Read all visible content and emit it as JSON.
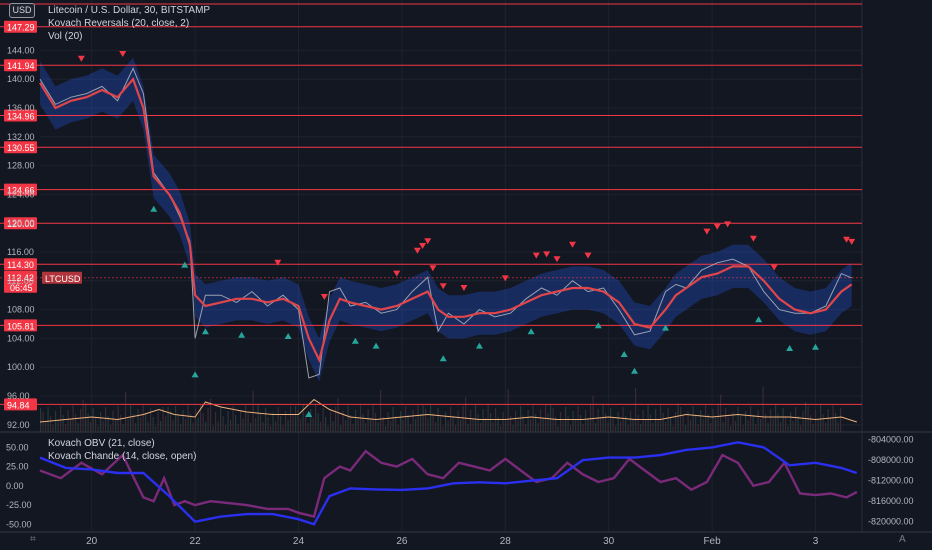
{
  "window": {
    "currency_badge": "USD",
    "auto_scale_label": "A"
  },
  "legend_top": [
    "Litecoin / U.S. Dollar, 30, BITSTAMP",
    "Kovach Reversals (20, close, 2)",
    "Vol (20)"
  ],
  "legend_bottom": [
    "Kovach OBV (21, close)",
    "Kovach Chande (14, close, open)"
  ],
  "colors": {
    "background": "#131722",
    "price": "#b2b5be",
    "ma": "#e0454a",
    "band": "#2962ff",
    "level": "#f23645",
    "volume_ma": "#f0b27a",
    "obv": "#2a2ff0",
    "chande": "#7b2a7a",
    "up_marker": "#26a69a",
    "down_marker": "#f23645",
    "axis_text": "#b2b5be",
    "grid": "#1e222d"
  },
  "chart_data": [
    {
      "type": "line",
      "title": "Litecoin / U.S. Dollar, 30, BITSTAMP",
      "ylim": [
        91,
        151
      ],
      "xlim": [
        19.0,
        34.9
      ],
      "x_tick_labels": [
        {
          "x": 20,
          "label": "20"
        },
        {
          "x": 22,
          "label": "22"
        },
        {
          "x": 24,
          "label": "24"
        },
        {
          "x": 26,
          "label": "26"
        },
        {
          "x": 28,
          "label": "28"
        },
        {
          "x": 30,
          "label": "30"
        },
        {
          "x": 32,
          "label": "Feb"
        },
        {
          "x": 34,
          "label": "3"
        }
      ],
      "y_ticks": [
        92,
        96,
        100,
        104,
        108,
        112,
        116,
        120,
        124,
        128,
        132,
        136,
        140,
        144
      ],
      "y_tick_labels": [
        "92.00",
        "96.00",
        "100.00",
        "104.00",
        "108.00",
        "112.00",
        "116.00",
        "120.00",
        "124.00",
        "128.00",
        "132.00",
        "136.00",
        "140.00",
        "144.00"
      ],
      "levels": [
        {
          "value": 147.29,
          "label": "147.29"
        },
        {
          "value": 141.94,
          "label": "141.94"
        },
        {
          "value": 134.96,
          "label": "134.96"
        },
        {
          "value": 130.55,
          "label": "130.55"
        },
        {
          "value": 124.66,
          "label": "124.66"
        },
        {
          "value": 120.0,
          "label": "120.00"
        },
        {
          "value": 114.3,
          "label": "114.30"
        },
        {
          "value": 105.81,
          "label": "105.81"
        },
        {
          "value": 94.84,
          "label": "94.84"
        }
      ],
      "current": {
        "label": "112.42",
        "symbol": "LTCUSD",
        "countdown": "06:45",
        "value": 112.42
      },
      "series": [
        {
          "name": "LTCUSD",
          "x": [
            19.0,
            19.3,
            19.6,
            19.9,
            20.2,
            20.5,
            20.8,
            21.0,
            21.2,
            21.5,
            21.7,
            21.9,
            22.0,
            22.2,
            22.5,
            22.8,
            23.1,
            23.4,
            23.7,
            24.0,
            24.2,
            24.4,
            24.6,
            24.8,
            25.0,
            25.3,
            25.6,
            25.9,
            26.2,
            26.5,
            26.7,
            26.9,
            27.2,
            27.5,
            27.8,
            28.1,
            28.4,
            28.7,
            29.0,
            29.3,
            29.6,
            29.9,
            30.2,
            30.5,
            30.8,
            31.1,
            31.3,
            31.5,
            31.8,
            32.1,
            32.4,
            32.7,
            33.0,
            33.3,
            33.6,
            33.9,
            34.2,
            34.5,
            34.7
          ],
          "values": [
            140.0,
            136.5,
            137.5,
            138.0,
            139.0,
            137.0,
            141.5,
            138.0,
            127.0,
            124.0,
            121.0,
            117.5,
            104.0,
            110.0,
            110.0,
            109.0,
            110.5,
            108.5,
            110.0,
            108.0,
            98.5,
            99.0,
            110.5,
            111.0,
            108.5,
            109.0,
            107.5,
            108.0,
            110.5,
            112.5,
            105.0,
            107.5,
            106.0,
            108.0,
            107.0,
            107.5,
            109.5,
            111.0,
            110.0,
            112.0,
            110.5,
            111.0,
            108.0,
            104.5,
            105.0,
            110.5,
            111.5,
            111.0,
            113.5,
            114.5,
            115.0,
            114.0,
            110.5,
            108.0,
            107.5,
            107.5,
            108.5,
            113.0,
            112.4
          ]
        },
        {
          "name": "MA",
          "x": [
            19.0,
            19.3,
            19.6,
            19.9,
            20.2,
            20.5,
            20.8,
            21.0,
            21.2,
            21.5,
            21.7,
            21.9,
            22.0,
            22.2,
            22.5,
            22.8,
            23.1,
            23.4,
            23.7,
            24.0,
            24.2,
            24.4,
            24.6,
            24.8,
            25.0,
            25.3,
            25.6,
            25.9,
            26.2,
            26.5,
            26.7,
            26.9,
            27.2,
            27.5,
            27.8,
            28.1,
            28.4,
            28.7,
            29.0,
            29.3,
            29.6,
            29.9,
            30.2,
            30.5,
            30.8,
            31.1,
            31.3,
            31.5,
            31.8,
            32.1,
            32.4,
            32.7,
            33.0,
            33.3,
            33.6,
            33.9,
            34.2,
            34.5,
            34.7
          ],
          "values": [
            139.5,
            136.0,
            137.0,
            137.5,
            138.5,
            137.5,
            140.0,
            136.0,
            126.5,
            124.0,
            121.5,
            117.0,
            110.0,
            108.5,
            109.0,
            109.5,
            109.5,
            109.0,
            109.5,
            108.5,
            104.0,
            101.0,
            106.5,
            109.5,
            109.0,
            108.5,
            108.0,
            108.5,
            109.5,
            110.5,
            108.0,
            107.0,
            107.0,
            107.5,
            107.5,
            108.0,
            109.0,
            110.0,
            110.5,
            111.0,
            111.0,
            110.5,
            109.0,
            106.0,
            105.5,
            108.0,
            110.0,
            111.0,
            112.5,
            113.0,
            114.0,
            114.0,
            112.0,
            109.5,
            108.0,
            107.5,
            108.0,
            110.5,
            111.5
          ]
        }
      ],
      "down_markers": [
        19.8,
        20.6,
        23.6,
        24.5,
        25.9,
        26.3,
        26.4,
        26.5,
        26.6,
        26.8,
        27.2,
        28.0,
        28.6,
        28.8,
        29.0,
        29.3,
        29.6,
        31.9,
        32.1,
        32.3,
        32.8,
        33.2,
        34.6,
        34.7
      ],
      "up_markers": [
        21.2,
        21.8,
        22.0,
        22.2,
        22.9,
        23.8,
        24.2,
        25.1,
        25.5,
        26.8,
        27.5,
        28.5,
        29.8,
        30.3,
        30.5,
        31.1,
        32.9,
        33.5,
        34.0
      ]
    },
    {
      "type": "line",
      "title": "Kovach OBV / Kovach Chande",
      "ylim": [
        -60,
        70
      ],
      "right_ylim": [
        -822000,
        -802500
      ],
      "y_ticks": [
        50,
        25,
        0,
        -25,
        -50
      ],
      "y_tick_labels": [
        "50.00",
        "25.00",
        "0.00",
        "-25.00",
        "-50.00"
      ],
      "right_y_ticks": [
        -804000,
        -808000,
        -812000,
        -816000,
        -820000
      ],
      "right_y_tick_labels": [
        "-804000.00",
        "-808000.00",
        "-812000.00",
        "-816000.00",
        "-820000.00"
      ],
      "series": [
        {
          "name": "Kovach OBV (21, close)",
          "axis": "right",
          "x": [
            19.0,
            19.5,
            20.0,
            20.5,
            21.0,
            21.5,
            22.0,
            22.5,
            23.0,
            23.5,
            24.0,
            24.3,
            24.6,
            25.0,
            25.5,
            26.0,
            26.5,
            27.0,
            27.5,
            28.0,
            28.5,
            29.0,
            29.5,
            30.0,
            30.5,
            31.0,
            31.5,
            32.0,
            32.5,
            33.0,
            33.5,
            34.0,
            34.5,
            34.8
          ],
          "values": [
            -807500,
            -809500,
            -809800,
            -810500,
            -810500,
            -815000,
            -820000,
            -819000,
            -818500,
            -818500,
            -819500,
            -820500,
            -815000,
            -813500,
            -813700,
            -813800,
            -813500,
            -812500,
            -812300,
            -812500,
            -812000,
            -811500,
            -808000,
            -807500,
            -807500,
            -807000,
            -806000,
            -805500,
            -804500,
            -805500,
            -809000,
            -808500,
            -809500,
            -810500
          ]
        },
        {
          "name": "Kovach Chande (14, close, open)",
          "axis": "left",
          "x": [
            19.0,
            19.4,
            19.8,
            20.2,
            20.6,
            21.0,
            21.2,
            21.4,
            21.6,
            21.8,
            22.0,
            22.3,
            22.6,
            23.0,
            23.4,
            23.8,
            24.0,
            24.3,
            24.5,
            24.8,
            25.0,
            25.3,
            25.6,
            25.9,
            26.2,
            26.5,
            26.8,
            27.1,
            27.4,
            27.7,
            28.0,
            28.3,
            28.6,
            28.9,
            29.2,
            29.5,
            29.8,
            30.1,
            30.4,
            30.7,
            31.0,
            31.3,
            31.6,
            31.9,
            32.2,
            32.5,
            32.8,
            33.1,
            33.4,
            33.7,
            34.0,
            34.3,
            34.6,
            34.8
          ],
          "values": [
            20,
            10,
            30,
            15,
            40,
            -15,
            -20,
            10,
            -25,
            -20,
            -25,
            -20,
            -22,
            -25,
            -30,
            -30,
            -35,
            -40,
            10,
            25,
            20,
            45,
            30,
            25,
            35,
            15,
            10,
            30,
            25,
            20,
            35,
            20,
            5,
            10,
            30,
            15,
            5,
            10,
            35,
            20,
            5,
            10,
            -5,
            5,
            40,
            30,
            0,
            5,
            30,
            -10,
            -12,
            -10,
            -15,
            -8
          ]
        }
      ]
    },
    {
      "type": "bar",
      "title": "Vol (20)",
      "series": [
        {
          "name": "Vol MA",
          "x": [
            19.0,
            19.5,
            20.0,
            20.5,
            21.0,
            21.3,
            21.6,
            22.0,
            22.2,
            22.5,
            23.0,
            23.5,
            24.0,
            24.3,
            24.6,
            25.0,
            25.5,
            26.0,
            26.5,
            27.0,
            27.5,
            28.0,
            28.5,
            29.0,
            29.5,
            30.0,
            30.5,
            31.0,
            31.5,
            32.0,
            32.5,
            33.0,
            33.5,
            34.0,
            34.5,
            34.8
          ],
          "values": [
            2.0,
            2.5,
            3.0,
            2.5,
            3.5,
            4.5,
            3.5,
            3.0,
            6.0,
            5.0,
            4.0,
            3.5,
            3.5,
            6.5,
            4.5,
            3.0,
            2.5,
            3.0,
            3.5,
            3.0,
            2.5,
            2.5,
            3.0,
            2.5,
            2.5,
            3.0,
            2.5,
            2.5,
            3.5,
            3.0,
            3.5,
            3.0,
            3.0,
            2.5,
            3.0,
            2.0
          ]
        }
      ]
    }
  ]
}
